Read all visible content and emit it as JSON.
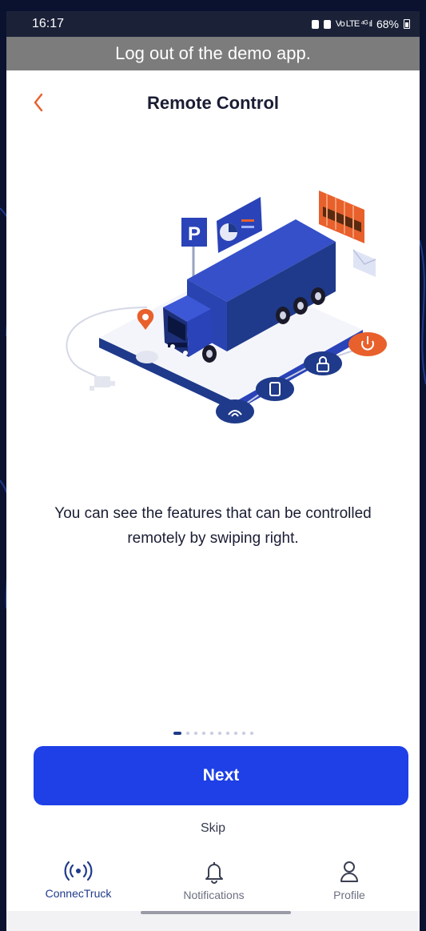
{
  "status_bar": {
    "time": "16:17",
    "signal": "Vo LTE ⁴ᴳ ıl",
    "battery": "68%"
  },
  "banner": {
    "text": "Log out of the demo app."
  },
  "header": {
    "title": "Remote Control"
  },
  "illustration": {
    "parking_sign": "P"
  },
  "description": "You can see the features that can be controlled remotely by swiping right.",
  "pager": {
    "count": 10,
    "active_index": 0
  },
  "actions": {
    "next_label": "Next",
    "skip_label": "Skip"
  },
  "bottom_nav": {
    "items": [
      {
        "label": "ConnecTruck",
        "icon": "broadcast-icon",
        "active": true
      },
      {
        "label": "Notifications",
        "icon": "bell-icon",
        "active": false
      },
      {
        "label": "Profile",
        "icon": "person-icon",
        "active": false
      }
    ]
  },
  "colors": {
    "primary": "#1e40e6",
    "accent": "#e8602c",
    "navy": "#1f3a8a"
  }
}
